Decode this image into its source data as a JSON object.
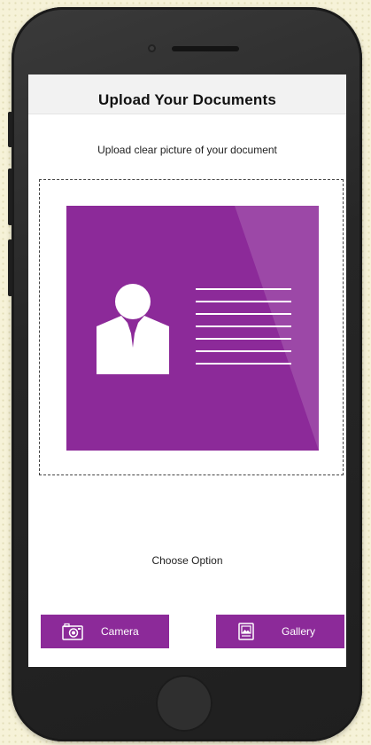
{
  "header": {
    "title": "Upload Your Documents"
  },
  "upload": {
    "instruction": "Upload clear picture of your document"
  },
  "options": {
    "prompt": "Choose Option",
    "camera_label": "Camera",
    "camera_icon": "camera-icon",
    "gallery_label": "Gallery",
    "gallery_icon": "image-gallery-icon"
  },
  "colors": {
    "accent": "#8c2a99",
    "background": "#f6f2d8",
    "phone_body": "#2b2b2b",
    "screen": "#ffffff"
  }
}
